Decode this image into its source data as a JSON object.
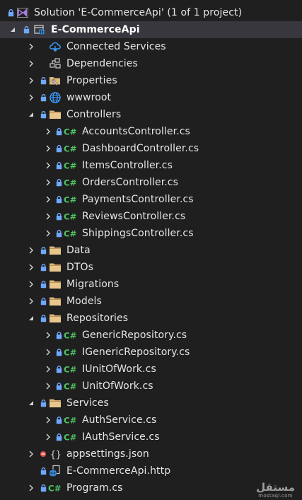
{
  "colors": {
    "background": "#1f1f1f",
    "selected_row": "#37373d",
    "text": "#e6e6e6",
    "folder": "#dcb67a",
    "csharp": "#4fc460",
    "lock": "#6ea8ff",
    "globe": "#3b9cff",
    "solution": "#a67de0",
    "error": "#e5534b"
  },
  "tree": [
    {
      "label": "Solution 'E-CommerceApi' (1 of 1 project)",
      "depth": 0,
      "arrow": "none",
      "lock": true,
      "icon": "solution-icon",
      "name": "solution-node"
    },
    {
      "label": "E-CommerceApi",
      "depth": 1,
      "arrow": "expanded",
      "lock": true,
      "icon": "web-project-icon",
      "name": "project-node",
      "selected": true
    },
    {
      "label": "Connected Services",
      "depth": 2,
      "arrow": "collapsed",
      "lock": false,
      "icon": "connected-services-icon",
      "name": "connected-services-node"
    },
    {
      "label": "Dependencies",
      "depth": 2,
      "arrow": "collapsed",
      "lock": false,
      "icon": "dependencies-icon",
      "name": "dependencies-node"
    },
    {
      "label": "Properties",
      "depth": 2,
      "arrow": "collapsed",
      "lock": true,
      "icon": "properties-folder-icon",
      "name": "properties-node"
    },
    {
      "label": "wwwroot",
      "depth": 2,
      "arrow": "collapsed",
      "lock": true,
      "icon": "globe-icon",
      "name": "wwwroot-node"
    },
    {
      "label": "Controllers",
      "depth": 2,
      "arrow": "expanded",
      "lock": true,
      "icon": "folder-icon",
      "name": "controllers-folder"
    },
    {
      "label": "AccountsController.cs",
      "depth": 3,
      "arrow": "collapsed",
      "lock": true,
      "icon": "csharp-file-icon",
      "name": "file-accounts-controller"
    },
    {
      "label": "DashboardController.cs",
      "depth": 3,
      "arrow": "collapsed",
      "lock": true,
      "icon": "csharp-file-icon",
      "name": "file-dashboard-controller"
    },
    {
      "label": "ItemsController.cs",
      "depth": 3,
      "arrow": "collapsed",
      "lock": true,
      "icon": "csharp-file-icon",
      "name": "file-items-controller"
    },
    {
      "label": "OrdersController.cs",
      "depth": 3,
      "arrow": "collapsed",
      "lock": true,
      "icon": "csharp-file-icon",
      "name": "file-orders-controller"
    },
    {
      "label": "PaymentsController.cs",
      "depth": 3,
      "arrow": "collapsed",
      "lock": true,
      "icon": "csharp-file-icon",
      "name": "file-payments-controller"
    },
    {
      "label": "ReviewsController.cs",
      "depth": 3,
      "arrow": "collapsed",
      "lock": true,
      "icon": "csharp-file-icon",
      "name": "file-reviews-controller"
    },
    {
      "label": "ShippingsController.cs",
      "depth": 3,
      "arrow": "collapsed",
      "lock": true,
      "icon": "csharp-file-icon",
      "name": "file-shippings-controller"
    },
    {
      "label": "Data",
      "depth": 2,
      "arrow": "collapsed",
      "lock": true,
      "icon": "folder-icon",
      "name": "data-folder"
    },
    {
      "label": "DTOs",
      "depth": 2,
      "arrow": "collapsed",
      "lock": true,
      "icon": "folder-icon",
      "name": "dtos-folder"
    },
    {
      "label": "Migrations",
      "depth": 2,
      "arrow": "collapsed",
      "lock": true,
      "icon": "folder-icon",
      "name": "migrations-folder"
    },
    {
      "label": "Models",
      "depth": 2,
      "arrow": "collapsed",
      "lock": true,
      "icon": "folder-icon",
      "name": "models-folder"
    },
    {
      "label": "Repositories",
      "depth": 2,
      "arrow": "expanded",
      "lock": true,
      "icon": "folder-icon",
      "name": "repositories-folder"
    },
    {
      "label": "GenericRepository.cs",
      "depth": 3,
      "arrow": "collapsed",
      "lock": true,
      "icon": "csharp-file-icon",
      "name": "file-generic-repository"
    },
    {
      "label": "IGenericRepository.cs",
      "depth": 3,
      "arrow": "collapsed",
      "lock": true,
      "icon": "csharp-file-icon",
      "name": "file-igeneric-repository"
    },
    {
      "label": "IUnitOfWork.cs",
      "depth": 3,
      "arrow": "collapsed",
      "lock": true,
      "icon": "csharp-file-icon",
      "name": "file-iunit-of-work"
    },
    {
      "label": "UnitOfWork.cs",
      "depth": 3,
      "arrow": "collapsed",
      "lock": true,
      "icon": "csharp-file-icon",
      "name": "file-unit-of-work"
    },
    {
      "label": "Services",
      "depth": 2,
      "arrow": "expanded",
      "lock": true,
      "icon": "folder-icon",
      "name": "services-folder"
    },
    {
      "label": "AuthService.cs",
      "depth": 3,
      "arrow": "collapsed",
      "lock": true,
      "icon": "csharp-file-icon",
      "name": "file-auth-service"
    },
    {
      "label": "IAuthService.cs",
      "depth": 3,
      "arrow": "collapsed",
      "lock": true,
      "icon": "csharp-file-icon",
      "name": "file-iauth-service"
    },
    {
      "label": "appsettings.json",
      "depth": 2,
      "arrow": "collapsed",
      "lock": false,
      "error": true,
      "icon": "json-file-icon",
      "name": "file-appsettings"
    },
    {
      "label": "E-CommerceApi.http",
      "depth": 2,
      "arrow": "none",
      "lock": true,
      "icon": "http-file-icon",
      "name": "file-http"
    },
    {
      "label": "Program.cs",
      "depth": 2,
      "arrow": "collapsed",
      "lock": true,
      "icon": "csharp-file-icon",
      "name": "file-program"
    }
  ],
  "watermark": {
    "arabic": "مستقل",
    "latin": "mostaql.com"
  }
}
